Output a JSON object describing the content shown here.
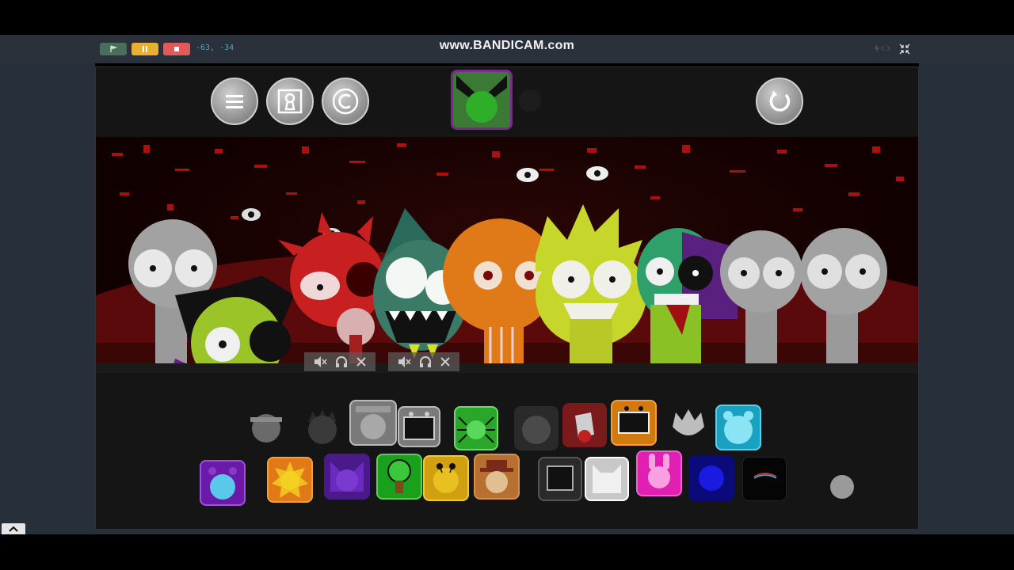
{
  "toolbar": {
    "coords": "-63, -34",
    "flag_icon": "flag-icon",
    "pause_icon": "pause-icon",
    "stop_icon": "stop-icon",
    "colors": {
      "flag": "#4a6e5a",
      "pause": "#e8b030",
      "stop": "#e05a5a"
    }
  },
  "watermark": "www.BANDICAM.com",
  "stage": {
    "menu_buttons": [
      "menu-icon",
      "keyhole-icon",
      "copyright-icon"
    ],
    "reset_button": "reset-icon",
    "mode_icons": [
      "mode-icon-green",
      "mode-icon-dark"
    ]
  },
  "scene": {
    "characters": [
      "gray-1",
      "green-cat",
      "red-spiky",
      "teal-shark",
      "orange-pumpkin",
      "yellow-spiky",
      "green-split",
      "gray-2",
      "gray-3"
    ],
    "mute_controls": [
      {
        "icons": [
          "mute-icon",
          "headphones-icon",
          "close-icon"
        ]
      },
      {
        "icons": [
          "mute-icon",
          "headphones-icon",
          "close-icon"
        ]
      }
    ]
  },
  "palette": {
    "row1": [
      "gray-headband",
      "gray-spiky",
      "gray-hat",
      "gray-tv",
      "green-spider",
      "dark-sphere",
      "red-bucket",
      "orange-tv",
      "white-spiky",
      "blue-bear"
    ],
    "row2": [
      "purple-bear",
      "orange-sun",
      "purple-cat",
      "green-tree",
      "yellow-bug",
      "brown-hat",
      "dark-tv",
      "white-cat",
      "pink-bunny",
      "blue-circle",
      "black-rainbow",
      "gray-small"
    ]
  }
}
